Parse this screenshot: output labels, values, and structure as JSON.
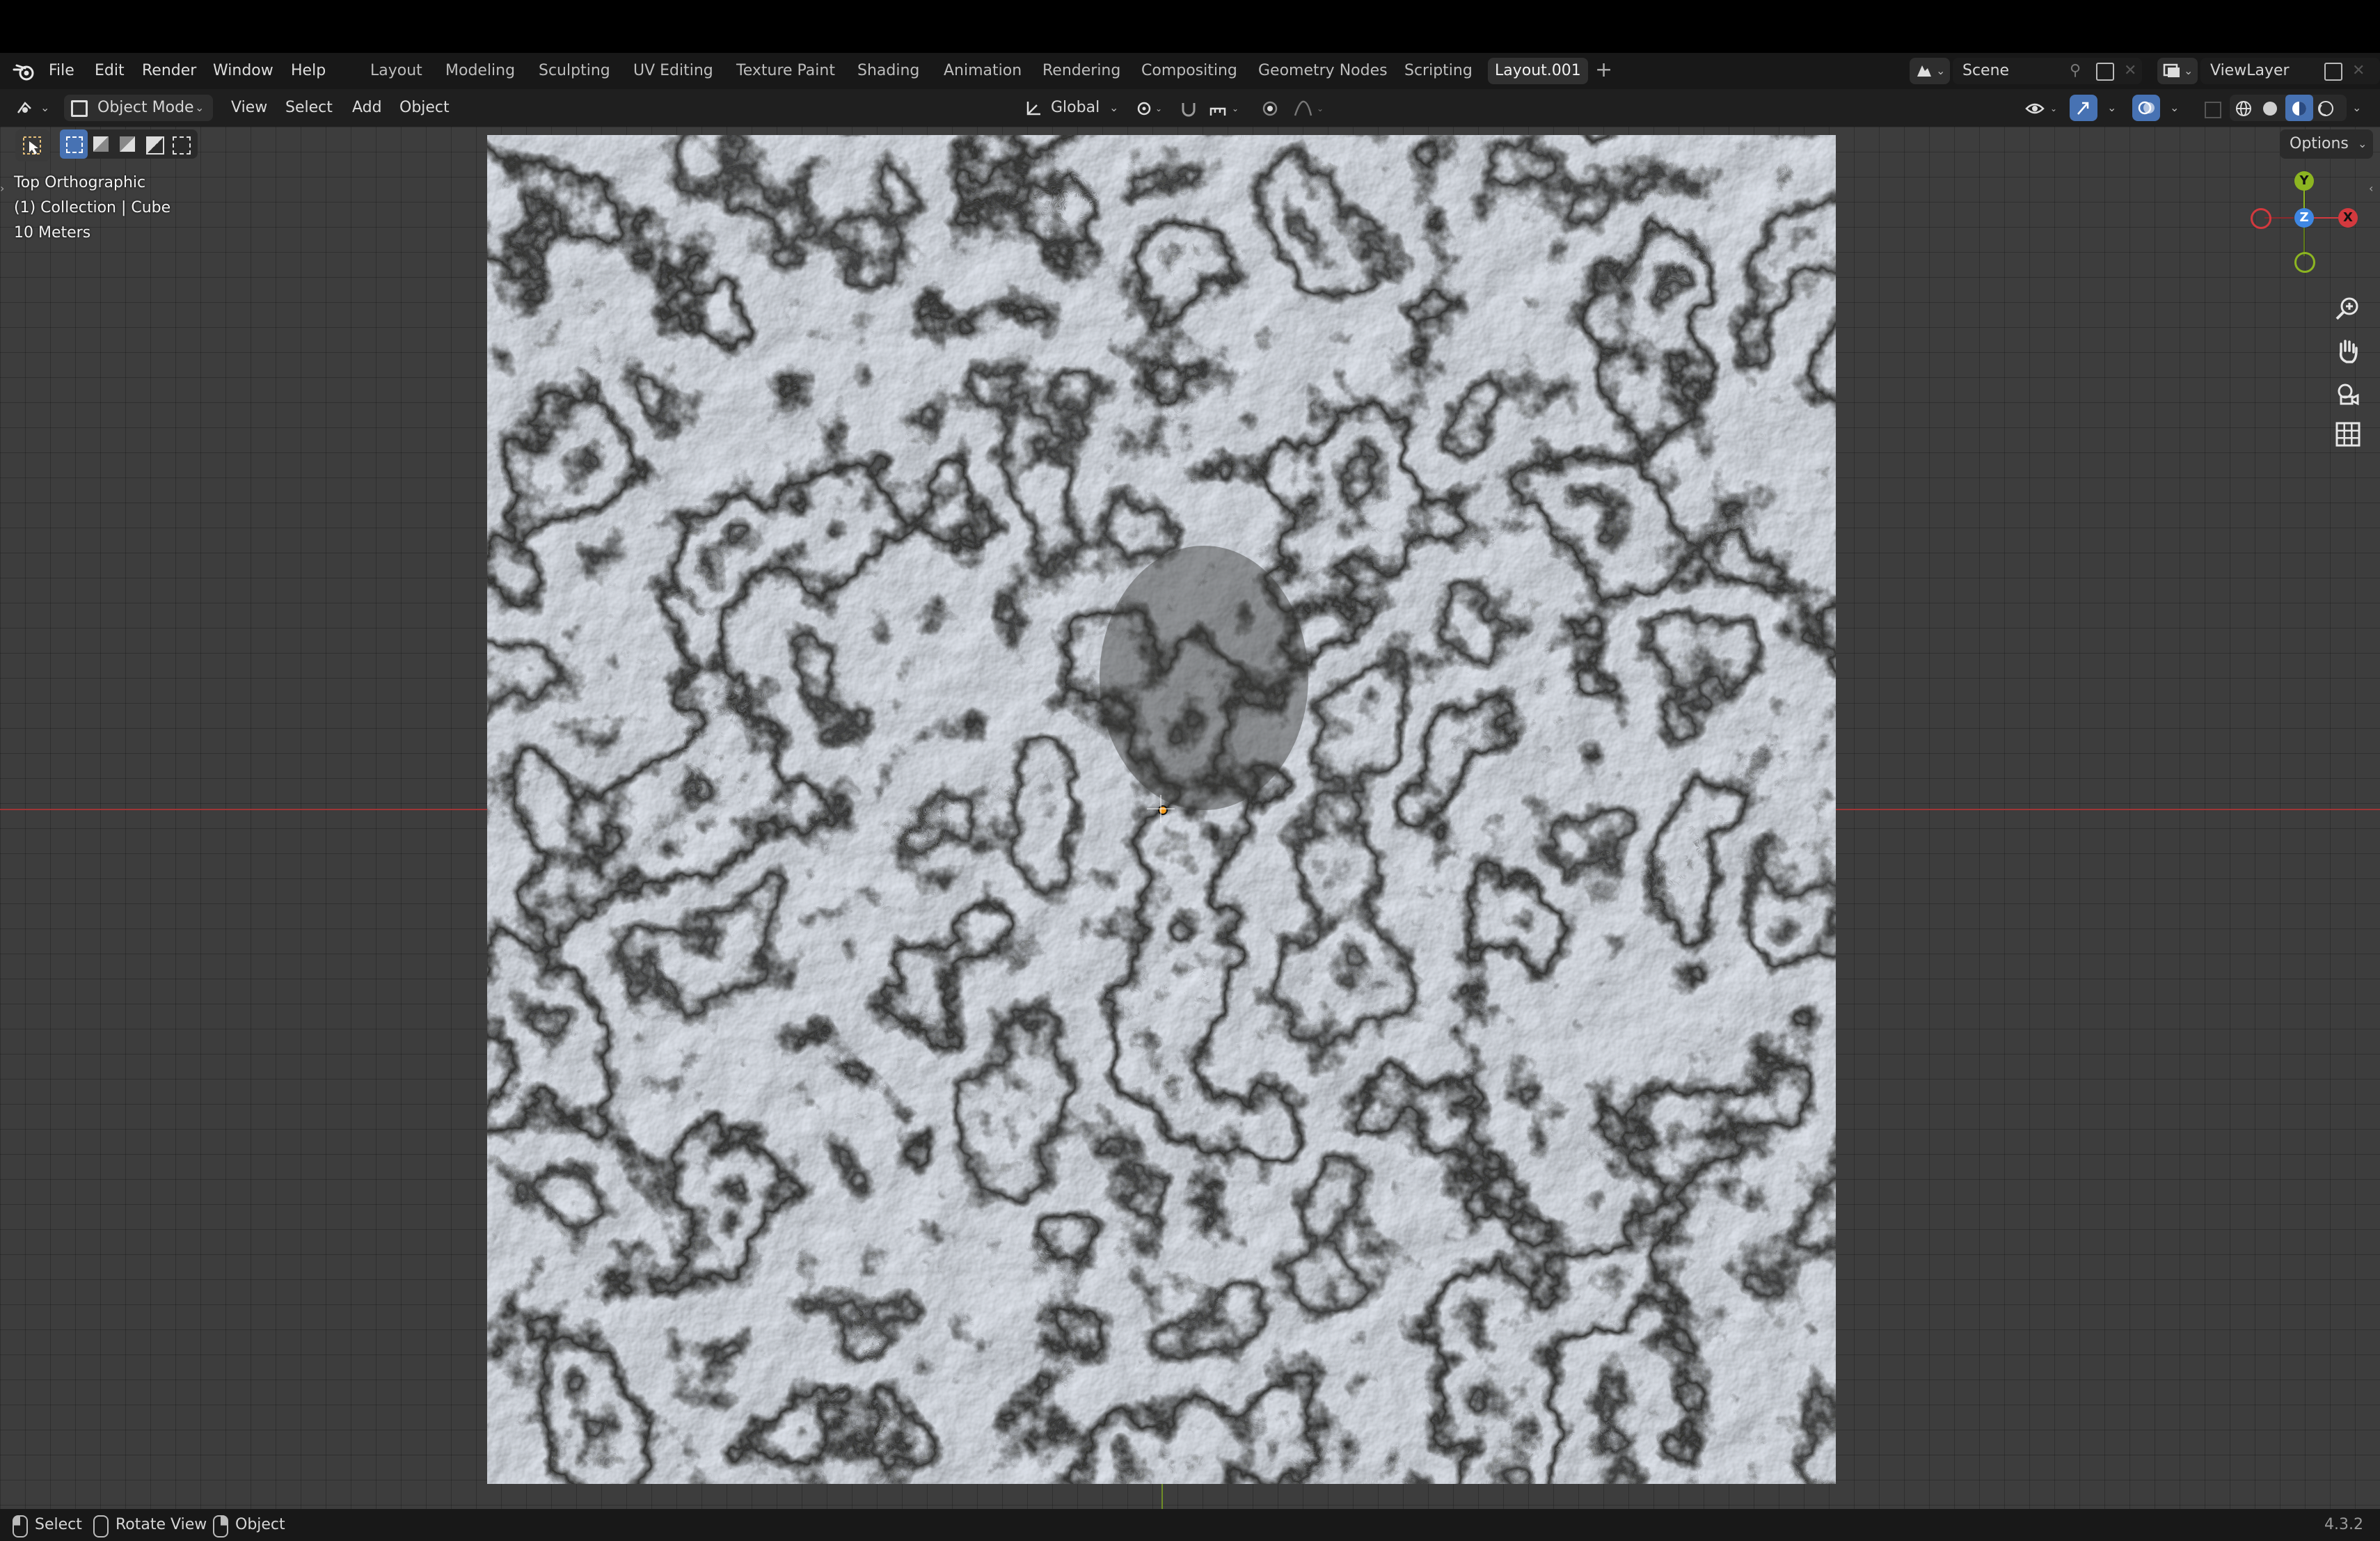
{
  "menu": {
    "file": "File",
    "edit": "Edit",
    "render": "Render",
    "window": "Window",
    "help": "Help"
  },
  "workspaces": [
    "Layout",
    "Modeling",
    "Sculpting",
    "UV Editing",
    "Texture Paint",
    "Shading",
    "Animation",
    "Rendering",
    "Compositing",
    "Geometry Nodes",
    "Scripting",
    "Layout.001"
  ],
  "active_workspace": "Layout.001",
  "scene": {
    "name": "Scene",
    "view_layer": "ViewLayer"
  },
  "header": {
    "mode": "Object Mode",
    "view": "View",
    "select": "Select",
    "add": "Add",
    "object": "Object",
    "transform_orientation": "Global",
    "options": "Options"
  },
  "viewport_info": {
    "view_name": "Top Orthographic",
    "collection": "(1) Collection | Cube",
    "scale": "10 Meters"
  },
  "gizmo": {
    "y": "Y",
    "z": "Z",
    "x": "X"
  },
  "status": {
    "select": "Select",
    "rotate_view": "Rotate View",
    "object": "Object",
    "version": "4.3.2"
  },
  "colors": {
    "accent": "#4772b3",
    "x_axis": "#d3393e",
    "y_axis": "#8cb521",
    "z_axis": "#3f87e3",
    "origin": "#f29a1a"
  },
  "icons": [
    "blender-logo-icon",
    "editor-type-icon",
    "object-mode-icon",
    "select-box-icon",
    "transform-global-icon",
    "pivot-icon",
    "snap-icon",
    "proportional-icon",
    "visibility-icon",
    "gizmo-icon",
    "overlay-icon",
    "xray-icon",
    "shading-wireframe-icon",
    "shading-solid-icon",
    "shading-material-icon",
    "shading-rendered-icon",
    "zoom-icon",
    "hand-pan-icon",
    "camera-view-icon",
    "grid-ortho-icon",
    "mouse-left-icon",
    "mouse-middle-icon",
    "mouse-right-icon"
  ]
}
